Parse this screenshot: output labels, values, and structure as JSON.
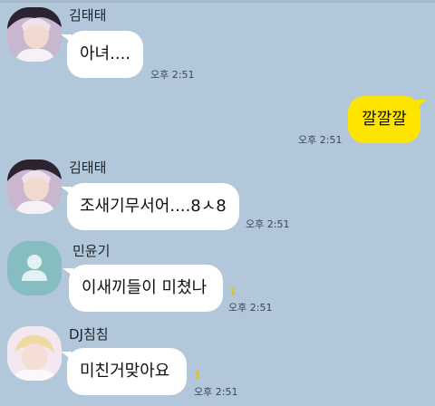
{
  "colors": {
    "background": "#b2c7da",
    "bubble_received": "#ffffff",
    "bubble_sent": "#fee500",
    "unread_count": "#e8c500"
  },
  "messages": [
    {
      "sender": "김태태",
      "avatar": "photo-avatar",
      "text": "아녀....",
      "time": "오후 2:51",
      "unread": ""
    },
    {
      "sender": "me",
      "text": "깔깔깔",
      "time": "오후 2:51",
      "unread": ""
    },
    {
      "sender": "김태태",
      "avatar": "photo-avatar",
      "text": "조새기무서어....8ㅅ8",
      "time": "오후 2:51",
      "unread": ""
    },
    {
      "sender": "민윤기",
      "avatar": "default-person-icon",
      "text": "이새끼들이 미쳤나",
      "time": "오후 2:51",
      "unread": "1"
    },
    {
      "sender": "DJ침침",
      "avatar": "photo-avatar",
      "text": "미친거맞아요",
      "time": "오후 2:51",
      "unread": "1"
    }
  ]
}
